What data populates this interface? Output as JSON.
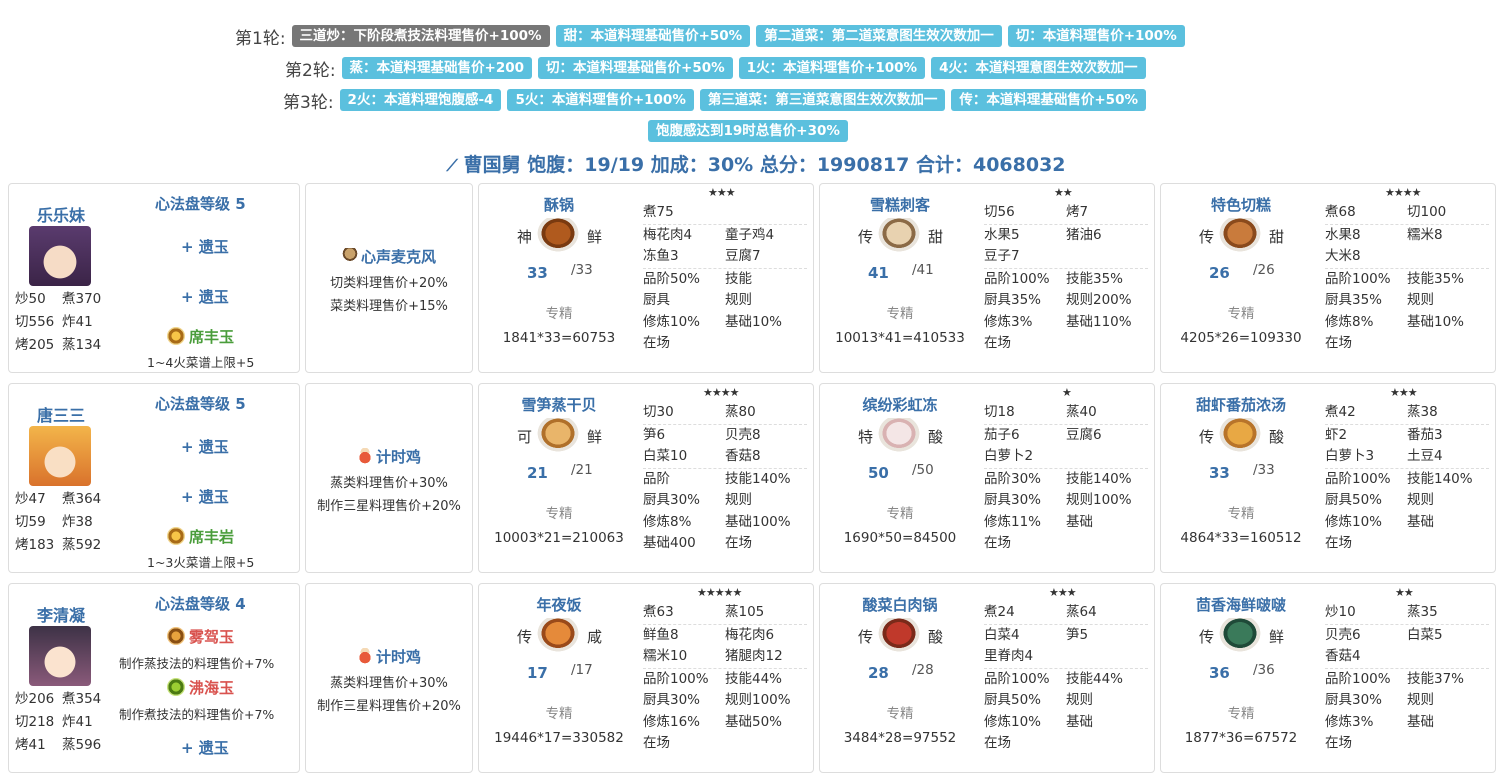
{
  "rounds": [
    {
      "label": "第1轮:",
      "tags": [
        {
          "text": "三道炒：下阶段煮技法料理售价+100%",
          "style": "gray"
        },
        {
          "text": "甜：本道料理基础售价+50%",
          "style": "blue"
        },
        {
          "text": "第二道菜：第二道菜意图生效次数加一",
          "style": "blue"
        },
        {
          "text": "切：本道料理售价+100%",
          "style": "blue"
        }
      ]
    },
    {
      "label": "第2轮:",
      "tags": [
        {
          "text": "蒸：本道料理基础售价+200",
          "style": "blue"
        },
        {
          "text": "切：本道料理基础售价+50%",
          "style": "blue"
        },
        {
          "text": "1火：本道料理售价+100%",
          "style": "blue"
        },
        {
          "text": "4火：本道料理意图生效次数加一",
          "style": "blue"
        }
      ]
    },
    {
      "label": "第3轮:",
      "tags": [
        {
          "text": "2火：本道料理饱腹感-4",
          "style": "blue"
        },
        {
          "text": "5火：本道料理售价+100%",
          "style": "blue"
        },
        {
          "text": "第三道菜：第三道菜意图生效次数加一",
          "style": "blue"
        },
        {
          "text": "传：本道料理基础售价+50%",
          "style": "blue"
        }
      ]
    },
    {
      "label": "",
      "tags": [
        {
          "text": "饱腹感达到19时总售价+30%",
          "style": "blue"
        }
      ]
    }
  ],
  "summary": "曹国舅 饱腹：19/19 加成：30% 总分：1990817 合计：4068032",
  "chefs": [
    {
      "name": "乐乐妹",
      "xinfa": "心法盘等级 5",
      "stats": [
        [
          "炒50",
          "煮370"
        ],
        [
          "切556",
          "炸41"
        ],
        [
          "烤205",
          "蒸134"
        ]
      ],
      "jades": [
        {
          "name": "遗玉",
          "kind": "plus"
        },
        {
          "name": "遗玉",
          "kind": "plus"
        },
        {
          "name": "席丰玉",
          "kind": "green"
        }
      ],
      "note": "1~4火菜谱上限+5",
      "equip": {
        "name": "心声麦克风",
        "lines": [
          "切类料理售价+20%",
          "菜类料理售价+15%"
        ]
      }
    },
    {
      "name": "唐三三",
      "xinfa": "心法盘等级 5",
      "stats": [
        [
          "炒47",
          "煮364"
        ],
        [
          "切59",
          "炸38"
        ],
        [
          "烤183",
          "蒸592"
        ]
      ],
      "jades": [
        {
          "name": "遗玉",
          "kind": "plus"
        },
        {
          "name": "遗玉",
          "kind": "plus"
        },
        {
          "name": "席丰岩",
          "kind": "green"
        }
      ],
      "note": "1~3火菜谱上限+5",
      "equip": {
        "name": "计时鸡",
        "lines": [
          "蒸类料理售价+30%",
          "制作三星料理售价+20%"
        ]
      }
    },
    {
      "name": "李清凝",
      "xinfa": "心法盘等级 4",
      "stats": [
        [
          "炒206",
          "煮354"
        ],
        [
          "切218",
          "炸41"
        ],
        [
          "烤41",
          "蒸596"
        ]
      ],
      "jades": [
        {
          "name": "雾驾玉",
          "kind": "red",
          "note": "制作蒸技法的料理售价+7%"
        },
        {
          "name": "沸海玉",
          "kind": "red",
          "note": "制作煮技法的料理售价+7%"
        },
        {
          "name": "遗玉",
          "kind": "plus"
        }
      ],
      "note": "",
      "equip": {
        "name": "计时鸡",
        "lines": [
          "蒸类料理售价+30%",
          "制作三星料理售价+20%"
        ]
      }
    }
  ],
  "dishes": [
    [
      {
        "name": "酥锅",
        "f1": "神",
        "f2": "鲜",
        "qty": "33",
        "max": "/33",
        "stars": "★★★",
        "formula": "1841*33=60753",
        "spec": "专精",
        "rows": [
          [
            "煮75",
            ""
          ],
          [
            "梅花肉4",
            "童子鸡4"
          ],
          [
            "冻鱼3",
            "豆腐7"
          ],
          [
            "品阶50%",
            "技能"
          ],
          [
            "厨具",
            "规则"
          ],
          [
            "修炼10%",
            "基础10%"
          ],
          [
            "在场",
            ""
          ]
        ],
        "sep": [
          0,
          2
        ]
      },
      {
        "name": "雪糕刺客",
        "f1": "传",
        "f2": "甜",
        "qty": "41",
        "max": "/41",
        "stars": "★★",
        "formula": "10013*41=410533",
        "spec": "专精",
        "rows": [
          [
            "切56",
            "烤7"
          ],
          [
            "水果5",
            "猪油6"
          ],
          [
            "豆子7",
            ""
          ],
          [
            "品阶100%",
            "技能35%"
          ],
          [
            "厨具35%",
            "规则200%"
          ],
          [
            "修炼3%",
            "基础110%"
          ],
          [
            "在场",
            ""
          ]
        ],
        "sep": [
          0,
          2
        ]
      },
      {
        "name": "特色切糕",
        "f1": "传",
        "f2": "甜",
        "qty": "26",
        "max": "/26",
        "stars": "★★★★",
        "formula": "4205*26=109330",
        "spec": "专精",
        "rows": [
          [
            "煮68",
            "切100"
          ],
          [
            "水果8",
            "糯米8"
          ],
          [
            "大米8",
            ""
          ],
          [
            "品阶100%",
            "技能35%"
          ],
          [
            "厨具35%",
            "规则"
          ],
          [
            "修炼8%",
            "基础10%"
          ],
          [
            "在场",
            ""
          ]
        ],
        "sep": [
          0,
          2
        ]
      }
    ],
    [
      {
        "name": "雪笋蒸干贝",
        "f1": "可",
        "f2": "鲜",
        "qty": "21",
        "max": "/21",
        "stars": "★★★★",
        "formula": "10003*21=210063",
        "spec": "专精",
        "rows": [
          [
            "切30",
            "蒸80"
          ],
          [
            "笋6",
            "贝壳8"
          ],
          [
            "白菜10",
            "香菇8"
          ],
          [
            "品阶",
            "技能140%"
          ],
          [
            "厨具30%",
            "规则"
          ],
          [
            "修炼8%",
            "基础100%"
          ],
          [
            "基础400",
            "在场"
          ]
        ],
        "sep": [
          0,
          2
        ]
      },
      {
        "name": "缤纷彩虹冻",
        "f1": "特",
        "f2": "酸",
        "qty": "50",
        "max": "/50",
        "stars": "★",
        "formula": "1690*50=84500",
        "spec": "专精",
        "rows": [
          [
            "切18",
            "蒸40"
          ],
          [
            "茄子6",
            "豆腐6"
          ],
          [
            "白萝卜2",
            ""
          ],
          [
            "品阶30%",
            "技能140%"
          ],
          [
            "厨具30%",
            "规则100%"
          ],
          [
            "修炼11%",
            "基础"
          ],
          [
            "在场",
            ""
          ]
        ],
        "sep": [
          0,
          2
        ]
      },
      {
        "name": "甜虾番茄浓汤",
        "f1": "传",
        "f2": "酸",
        "qty": "33",
        "max": "/33",
        "stars": "★★★",
        "formula": "4864*33=160512",
        "spec": "专精",
        "rows": [
          [
            "煮42",
            "蒸38"
          ],
          [
            "虾2",
            "番茄3"
          ],
          [
            "白萝卜3",
            "土豆4"
          ],
          [
            "品阶100%",
            "技能140%"
          ],
          [
            "厨具50%",
            "规则"
          ],
          [
            "修炼10%",
            "基础"
          ],
          [
            "在场",
            ""
          ]
        ],
        "sep": [
          0,
          2
        ]
      }
    ],
    [
      {
        "name": "年夜饭",
        "f1": "传",
        "f2": "咸",
        "qty": "17",
        "max": "/17",
        "stars": "★★★★★",
        "formula": "19446*17=330582",
        "spec": "专精",
        "rows": [
          [
            "煮63",
            "蒸105"
          ],
          [
            "鲜鱼8",
            "梅花肉6"
          ],
          [
            "糯米10",
            "猪腿肉12"
          ],
          [
            "品阶100%",
            "技能44%"
          ],
          [
            "厨具30%",
            "规则100%"
          ],
          [
            "修炼16%",
            "基础50%"
          ],
          [
            "在场",
            ""
          ]
        ],
        "sep": [
          0,
          2
        ]
      },
      {
        "name": "酸菜白肉锅",
        "f1": "传",
        "f2": "酸",
        "qty": "28",
        "max": "/28",
        "stars": "★★★",
        "formula": "3484*28=97552",
        "spec": "专精",
        "rows": [
          [
            "煮24",
            "蒸64"
          ],
          [
            "白菜4",
            "笋5"
          ],
          [
            "里脊肉4",
            ""
          ],
          [
            "品阶100%",
            "技能44%"
          ],
          [
            "厨具50%",
            "规则"
          ],
          [
            "修炼10%",
            "基础"
          ],
          [
            "在场",
            ""
          ]
        ],
        "sep": [
          0,
          2
        ]
      },
      {
        "name": "茴香海鲜啵啵",
        "f1": "传",
        "f2": "鲜",
        "qty": "36",
        "max": "/36",
        "stars": "★★",
        "formula": "1877*36=67572",
        "spec": "专精",
        "rows": [
          [
            "炒10",
            "蒸35"
          ],
          [
            "贝壳6",
            "白菜5"
          ],
          [
            "香菇4",
            ""
          ],
          [
            "品阶100%",
            "技能37%"
          ],
          [
            "厨具30%",
            "规则"
          ],
          [
            "修炼3%",
            "基础"
          ],
          [
            "在场",
            ""
          ]
        ],
        "sep": [
          0,
          2
        ]
      }
    ]
  ]
}
